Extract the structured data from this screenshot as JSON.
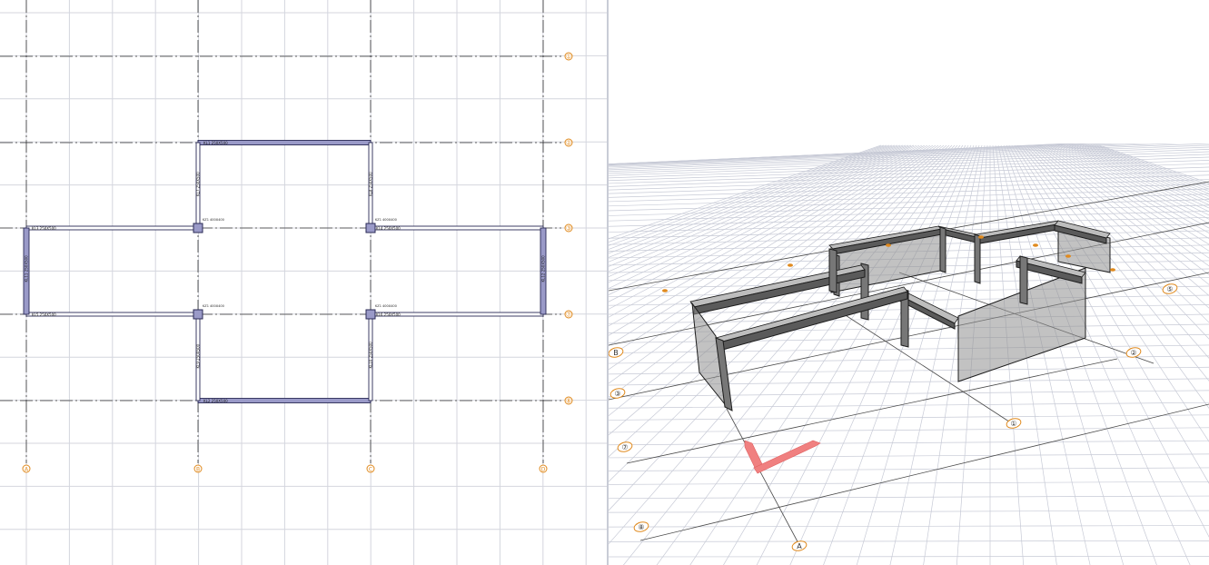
{
  "plan_view": {
    "grid_rows": [
      "①",
      "②",
      "③",
      "⑦",
      "⑧"
    ],
    "grid_cols": [
      "A",
      "B",
      "C",
      "D"
    ],
    "beam_labels": [
      "KL1 250X500",
      "KL2 250X500",
      "KL3 250X500",
      "KL4 250X500",
      "KL5 250X500",
      "KL6 250X500",
      "KL7 250X500",
      "KL8 250X500",
      "KL9 250X500",
      "KL10 250X500",
      "KL11 250X500",
      "KL12 250X500"
    ],
    "column_labels": [
      "KZ1 400X400",
      "KZ1 400X400",
      "KZ1 400X400",
      "KZ1 400X400"
    ]
  },
  "model_view": {
    "axis_tags": [
      "⑦",
      "⑧",
      "A",
      "B",
      "③",
      "②",
      "①",
      "⑤"
    ]
  },
  "colors": {
    "grid": "#d4d6de",
    "axis_line": "#333333",
    "beam_fill": "#9a9ac8",
    "beam_stroke": "#2a2a55",
    "axis_marker": "#e08a1e",
    "ucs_arrow": "#f08080",
    "wall_fill": "#8f8f8f",
    "floor_grid": "#c7cad6"
  }
}
